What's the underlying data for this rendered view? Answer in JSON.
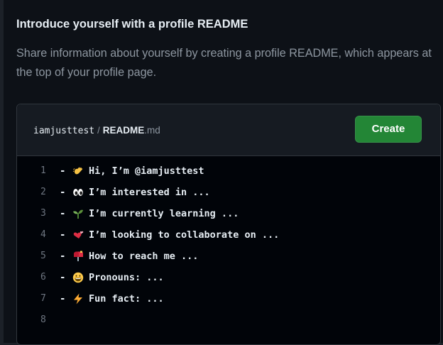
{
  "title": "Introduce yourself with a profile README",
  "description": "Share information about yourself by creating a profile README, which appears at the top of your profile page.",
  "editor": {
    "username": "iamjusttest",
    "separator": "/",
    "filename": "README",
    "extension": ".md",
    "create_label": "Create"
  },
  "lines": [
    {
      "num": "1",
      "dash": "-",
      "icon": "waving-hand-icon",
      "text": "Hi, I’m @iamjusttest"
    },
    {
      "num": "2",
      "dash": "-",
      "icon": "eyes-icon",
      "text": "I’m interested in ..."
    },
    {
      "num": "3",
      "dash": "-",
      "icon": "seedling-icon",
      "text": "I’m currently learning ..."
    },
    {
      "num": "4",
      "dash": "-",
      "icon": "revolving-hearts-icon",
      "text": "I’m looking to collaborate on ..."
    },
    {
      "num": "5",
      "dash": "-",
      "icon": "mailbox-icon",
      "text": "How to reach me ..."
    },
    {
      "num": "6",
      "dash": "-",
      "icon": "smiley-icon",
      "text": "Pronouns: ..."
    },
    {
      "num": "7",
      "dash": "-",
      "icon": "lightning-icon",
      "text": "Fun fact: ..."
    },
    {
      "num": "8",
      "dash": "",
      "icon": "",
      "text": ""
    }
  ],
  "colors": {
    "background": "#0d1117",
    "button_green": "#238636",
    "text_primary": "#e6edf3",
    "text_muted": "#8d96a0"
  }
}
